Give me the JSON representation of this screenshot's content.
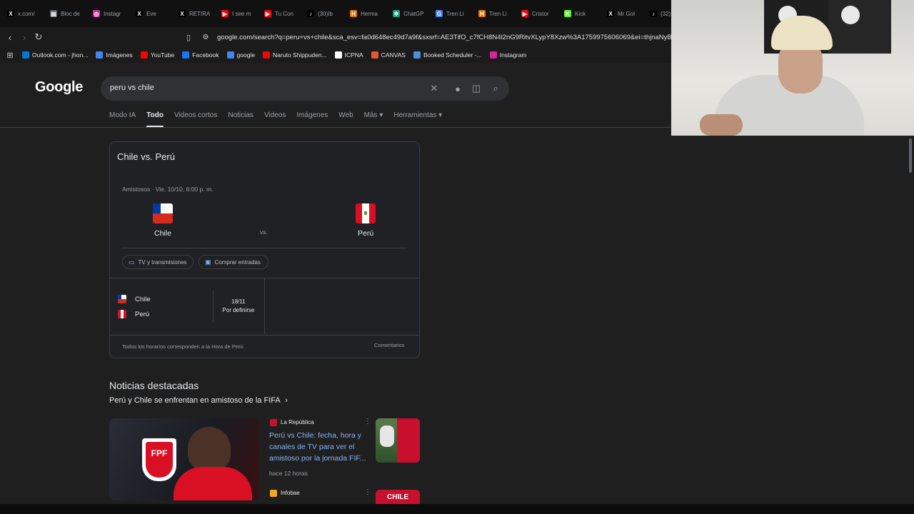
{
  "browser": {
    "tabs": [
      {
        "label": "x.com/",
        "icon": "x-icon",
        "color": "#000000",
        "glyph": "X"
      },
      {
        "label": "Bloc de",
        "icon": "notepad-icon",
        "color": "#5f6368",
        "glyph": "▤"
      },
      {
        "label": "Instagr",
        "icon": "instagram-icon",
        "color": "#d6249f",
        "glyph": "◎"
      },
      {
        "label": "Eve",
        "icon": "x-icon",
        "color": "#000000",
        "glyph": "X"
      },
      {
        "label": "RETIRA",
        "icon": "x-icon",
        "color": "#000000",
        "glyph": "X"
      },
      {
        "label": "I see m",
        "icon": "youtube-icon",
        "color": "#ff0000",
        "glyph": "▶"
      },
      {
        "label": "Tu Con",
        "icon": "youtube-icon",
        "color": "#ff0000",
        "glyph": "▶"
      },
      {
        "label": "(30)Ib",
        "icon": "tiktok-icon",
        "color": "#000000",
        "glyph": "♪"
      },
      {
        "label": "Herma",
        "icon": "bookmark-icon",
        "color": "#e37400",
        "glyph": "H"
      },
      {
        "label": "ChatGP",
        "icon": "chatgpt-icon",
        "color": "#10a37f",
        "glyph": "✲"
      },
      {
        "label": "Tren Li",
        "icon": "google-icon",
        "color": "#4285f4",
        "glyph": "G"
      },
      {
        "label": "Tren Li",
        "icon": "bookmark-icon",
        "color": "#e37400",
        "glyph": "H"
      },
      {
        "label": "Cristor",
        "icon": "youtube-icon",
        "color": "#ff0000",
        "glyph": "▶"
      },
      {
        "label": "Kick",
        "icon": "kick-icon",
        "color": "#53fc18",
        "glyph": "K"
      },
      {
        "label": "Mr Gol",
        "icon": "x-icon",
        "color": "#000000",
        "glyph": "X"
      },
      {
        "label": "(32)",
        "icon": "tiktok-icon",
        "color": "#000000",
        "glyph": "♪"
      }
    ],
    "url": "google.com/search?q=peru+vs+chile&sca_esv=fa0d648ec49d7a9f&sxsrf=AE3TifO_c7fCH8N4l2nG9RitvXLypY8Xzw%3A1759975606069&ei=thjnaNyBBM-",
    "bookmarks": [
      {
        "label": "Outlook.com - jhon...",
        "icon": "outlook-icon",
        "color": "#0078d4"
      },
      {
        "label": "Imágenes",
        "icon": "google-icon",
        "color": "#4285f4"
      },
      {
        "label": "YouTube",
        "icon": "youtube-icon",
        "color": "#ff0000"
      },
      {
        "label": "Facebook",
        "icon": "facebook-icon",
        "color": "#1877f2"
      },
      {
        "label": "google",
        "icon": "google-icon",
        "color": "#4285f4"
      },
      {
        "label": "Naruto Shippuden...",
        "icon": "youtube-icon",
        "color": "#ff0000"
      },
      {
        "label": "ICPNA",
        "icon": "icpna-icon",
        "color": "#ffffff"
      },
      {
        "label": "CANVAS",
        "icon": "canvas-icon",
        "color": "#e4572e"
      },
      {
        "label": "Booked Scheduler -...",
        "icon": "dot-icon",
        "color": "#4a90d9"
      },
      {
        "label": "Instagram",
        "icon": "instagram-icon",
        "color": "#d6249f"
      }
    ]
  },
  "google": {
    "logo": "Google",
    "query": "peru vs chile",
    "tabs": [
      "Modo IA",
      "Todo",
      "Videos cortos",
      "Noticias",
      "Videos",
      "Imágenes",
      "Web",
      "Más ▾",
      "Herramientas ▾"
    ],
    "active_tab": "Todo"
  },
  "match_card": {
    "title": "Chile vs. Perú",
    "info": "Amistosos · Vie, 10/10, 6:00 p. m.",
    "home": "Chile",
    "away": "Perú",
    "vs": "vs.",
    "chip_tv": "TV y transmisiones",
    "chip_tickets": "Comprar entradas",
    "schedule": {
      "team1": "Chile",
      "team2": "Perú",
      "date": "18/11",
      "status": "Por definirse"
    },
    "footnote": "Todos los horarios corresponden a la Hora de Perú",
    "comments": "Comentarios"
  },
  "news": {
    "heading": "Noticias destacadas",
    "subheading": "Perú y Chile se enfrentan en amistoso de la FIFA",
    "article1": {
      "source": "La República",
      "title": "Perú vs Chile: fecha, hora y canales de TV para ver el amistoso por la jornada FIF...",
      "time": "hace 12 horas"
    },
    "article2": {
      "source": "Infobae",
      "thumb_text": "CHILE"
    },
    "image_badge": "FPF"
  },
  "colors": {
    "link": "#8ab4f8",
    "background": "#1f1f1f",
    "chile_red": "#d52b1e",
    "chile_blue": "#0039a6",
    "peru_red": "#d91023"
  }
}
